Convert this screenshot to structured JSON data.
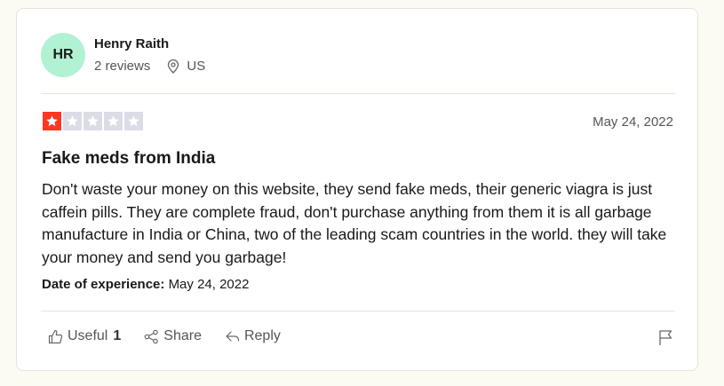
{
  "review": {
    "author": {
      "initials": "HR",
      "name": "Henry Raith",
      "reviews_count": "2 reviews",
      "country": "US",
      "avatar_color": "#b1f2d2"
    },
    "rating": 1,
    "rating_max": 5,
    "star_color": "#ff3722",
    "date": "May 24, 2022",
    "title": "Fake meds from India",
    "body": "Don't waste your money on this website, they send fake meds, their generic viagra is just caffein pills. They are complete fraud, don't purchase anything from them it is all garbage manufacture in India or China, two of the leading scam countries in the world. they will take your money and send you garbage!",
    "experience_label": "Date of experience:",
    "experience_date": "May 24, 2022"
  },
  "actions": {
    "useful_label": "Useful",
    "useful_count": "1",
    "share_label": "Share",
    "reply_label": "Reply"
  },
  "icons": {
    "location": "location-pin-icon",
    "useful": "thumbs-up-icon",
    "share": "share-icon",
    "reply": "reply-icon",
    "flag": "flag-icon"
  }
}
